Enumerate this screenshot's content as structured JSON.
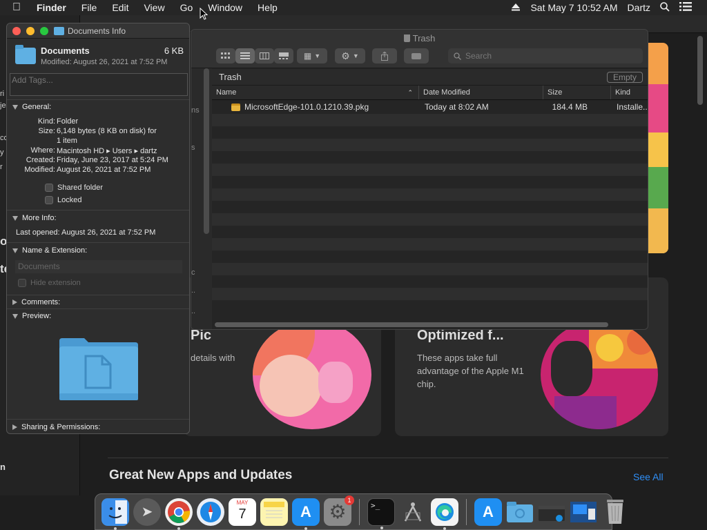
{
  "menubar": {
    "app_name": "Finder",
    "items": [
      "File",
      "Edit",
      "View",
      "Go",
      "Window",
      "Help"
    ],
    "datetime": "Sat May 7  10:52 AM",
    "user": "Dartz"
  },
  "appstore": {
    "card1_title": "Pic",
    "card1_desc": "details with",
    "card2_title": "Optimized f...",
    "card2_desc": "These apps take full advantage of the Apple M1 chip.",
    "section_title": "Great New Apps and Updates",
    "see_all": "See All",
    "left_fragments": [
      "ri",
      "je",
      "co",
      "y",
      "r",
      "o",
      "te",
      "n"
    ],
    "sidebar_fragments": [
      "ns",
      "s",
      "c",
      "..",
      ".."
    ]
  },
  "trash": {
    "title": "Trash",
    "search_placeholder": "Search",
    "path_label": "Trash",
    "empty_button": "Empty",
    "columns": [
      "Name",
      "Date Modified",
      "Size",
      "Kind"
    ],
    "files": [
      {
        "name": "MicrosoftEdge-101.0.1210.39.pkg",
        "date": "Today at 8:02 AM",
        "size": "184.4 MB",
        "kind": "Installe..."
      }
    ]
  },
  "info": {
    "window_title": "Documents Info",
    "name": "Documents",
    "size": "6 KB",
    "modified_line": "Modified: August 26, 2021 at 7:52 PM",
    "tags_placeholder": "Add Tags...",
    "general_label": "General:",
    "general": {
      "kind_k": "Kind:",
      "kind_v": "Folder",
      "size_k": "Size:",
      "size_v1": "6,148 bytes (8 KB on disk) for",
      "size_v2": "1 item",
      "where_k": "Where:",
      "where_v": "Macintosh HD ▸ Users ▸ dartz",
      "created_k": "Created:",
      "created_v": "Friday, June 23, 2017 at 5:24 PM",
      "modified_k": "Modified:",
      "modified_v": "August 26, 2021 at 7:52 PM"
    },
    "shared_folder": "Shared folder",
    "locked": "Locked",
    "more_info_label": "More Info:",
    "last_opened": "Last opened: August 26, 2021 at 7:52 PM",
    "name_ext_label": "Name & Extension:",
    "name_field": "Documents",
    "hide_extension": "Hide extension",
    "comments_label": "Comments:",
    "preview_label": "Preview:",
    "sharing_label": "Sharing & Permissions:"
  },
  "dock": {
    "calendar_month": "MAY",
    "calendar_day": "7",
    "settings_badge": "1"
  },
  "colors": {
    "accent_blue": "#2f8ff7",
    "folder_blue": "#5fb0e3",
    "close_red": "#fe5f57",
    "minimize_yellow": "#febc2e",
    "zoom_green": "#28c840"
  }
}
